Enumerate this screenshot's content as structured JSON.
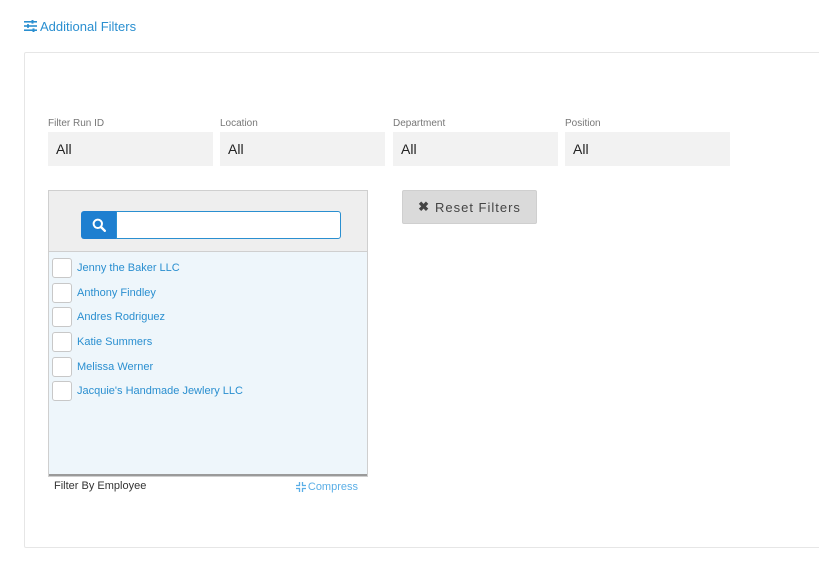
{
  "filters_toggle": {
    "label": "Additional Filters",
    "icon": "sliders-icon"
  },
  "fields": [
    {
      "label": "Filter Run ID",
      "value": "All"
    },
    {
      "label": "Location",
      "value": "All"
    },
    {
      "label": "Department",
      "value": "All"
    },
    {
      "label": "Position",
      "value": "All"
    }
  ],
  "employee_filter": {
    "search_value": "",
    "search_icon": "search-icon",
    "employees": [
      "Jenny the Baker LLC",
      "Anthony Findley",
      "Andres Rodriguez",
      "Katie Summers",
      "Melissa Werner",
      "Jacquie's Handmade Jewlery LLC"
    ],
    "label": "Filter By Employee",
    "compress_label": "Compress"
  },
  "reset_button": {
    "label": "Reset Filters",
    "icon": "close-icon"
  },
  "colors": {
    "accent": "#2a8fd0",
    "search_button": "#1e7fd0",
    "list_bg": "#eef6fb"
  }
}
